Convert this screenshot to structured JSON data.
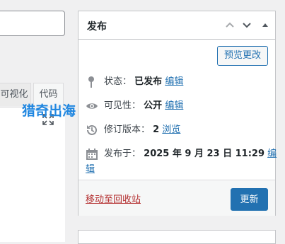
{
  "editor": {
    "tabs": [
      {
        "label": "可视化"
      },
      {
        "label": "代码"
      }
    ],
    "watermark": "猎奇出海"
  },
  "publish_box": {
    "title": "发布",
    "preview_button": "预览更改",
    "status": {
      "label": "状态：",
      "value": "已发布",
      "edit": "编辑"
    },
    "visibility": {
      "label": "可见性：",
      "value": "公开",
      "edit": "编辑"
    },
    "revisions": {
      "label": "修订版本：",
      "value": "2",
      "browse": "浏览"
    },
    "published_on": {
      "label": "发布于：",
      "value": "2025 年 9 月 23 日 11:29",
      "edit_part1": "编",
      "edit_part2": "辑"
    },
    "trash_link": "移动至回收站",
    "update_button": "更新"
  },
  "icons": {
    "status": "pin-icon",
    "visibility": "eye-icon",
    "revisions": "history-icon",
    "published_on": "calendar-icon"
  },
  "colors": {
    "accent": "#2271b1",
    "trash": "#b32d2e",
    "watermark": "#1f86e0"
  }
}
